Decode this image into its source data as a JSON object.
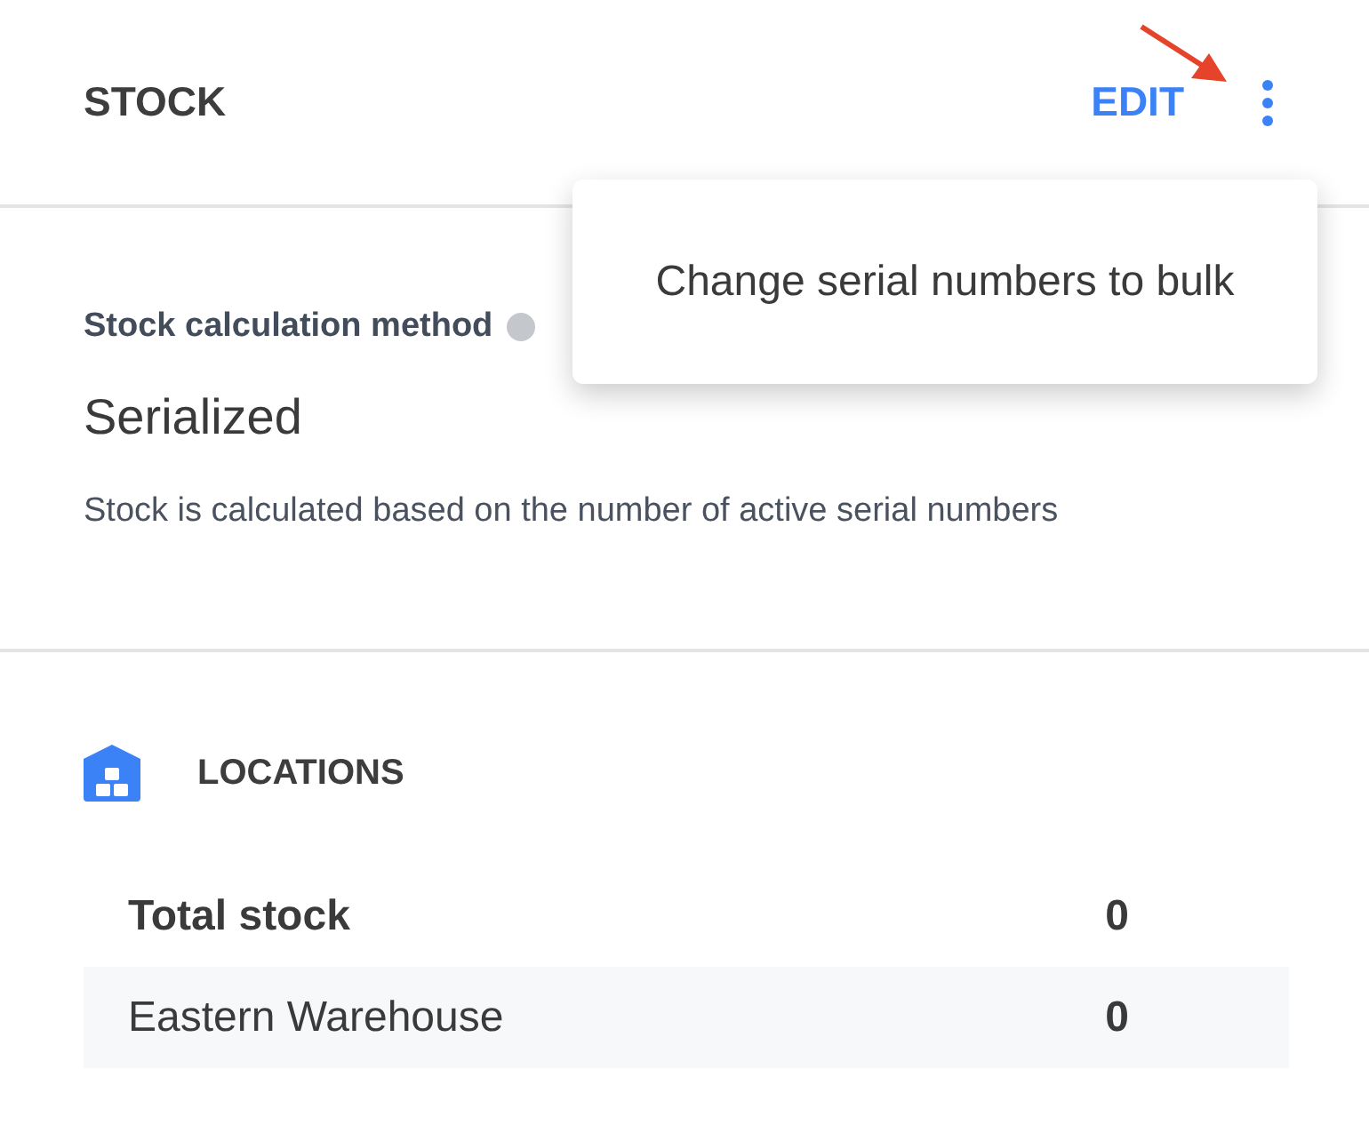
{
  "header": {
    "title": "STOCK",
    "edit_button": "EDIT"
  },
  "menu": {
    "open": true,
    "items": [
      "Change serial numbers to bulk"
    ]
  },
  "calculation": {
    "label": "Stock calculation method",
    "value": "Serialized",
    "description": "Stock is calculated based on the number of active serial numbers"
  },
  "locations": {
    "title": "LOCATIONS",
    "rows": [
      {
        "kind": "total",
        "name": "Total stock",
        "quantity": "0"
      },
      {
        "kind": "location",
        "name": "Eastern Warehouse",
        "quantity": "0"
      }
    ]
  }
}
